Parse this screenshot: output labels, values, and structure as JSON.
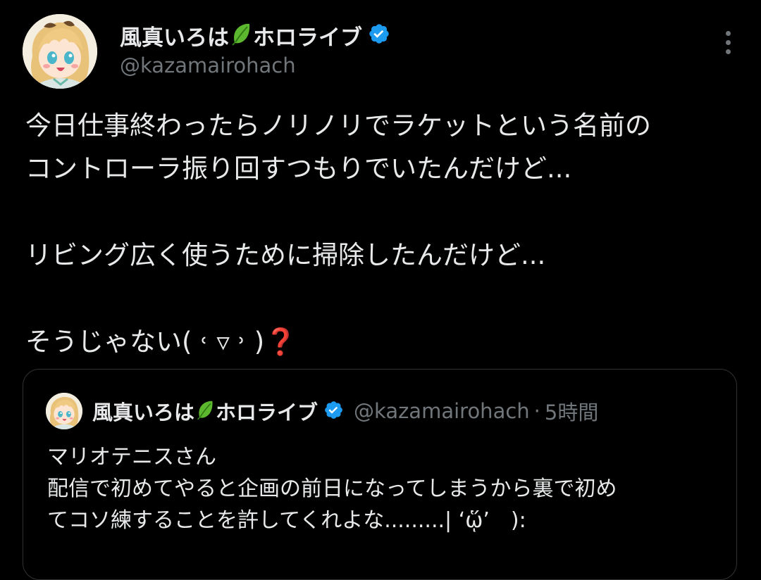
{
  "author": {
    "display_name": "風真いろは",
    "org_name": "ホロライブ",
    "handle": "@kazamairohach",
    "verified": true,
    "avatar_icon": "anime-girl-avatar"
  },
  "icons": {
    "leaf": "leaf-icon",
    "verified": "verified-badge-icon",
    "more": "more-options-icon"
  },
  "colors": {
    "background": "#000000",
    "text": "#e7e9ea",
    "muted": "#71767b",
    "verified_blue": "#1d9bf0",
    "leaf_green": "#5cb82e",
    "border": "#2f3336"
  },
  "tweet": {
    "lines": [
      "今日仕事終わったらノリノリでラケットという名前の",
      "コントローラ振り回すつもりでいたんだけど...",
      "",
      "リビング広く使うために掃除したんだけど...",
      "",
      "そうじゃない( ˓ ▿ ˒ )"
    ],
    "emoji_question": "❓"
  },
  "quote": {
    "display_name": "風真いろは",
    "org_name": "ホロライブ",
    "handle": "@kazamairohach",
    "separator": "·",
    "time": "5時間",
    "lines": [
      "マリオテニスさん",
      "配信で初めてやると企画の前日になってしまうから裏で初め",
      "てコソ練することを許してくれよな.........| ‘ᾥ’　):"
    ]
  }
}
